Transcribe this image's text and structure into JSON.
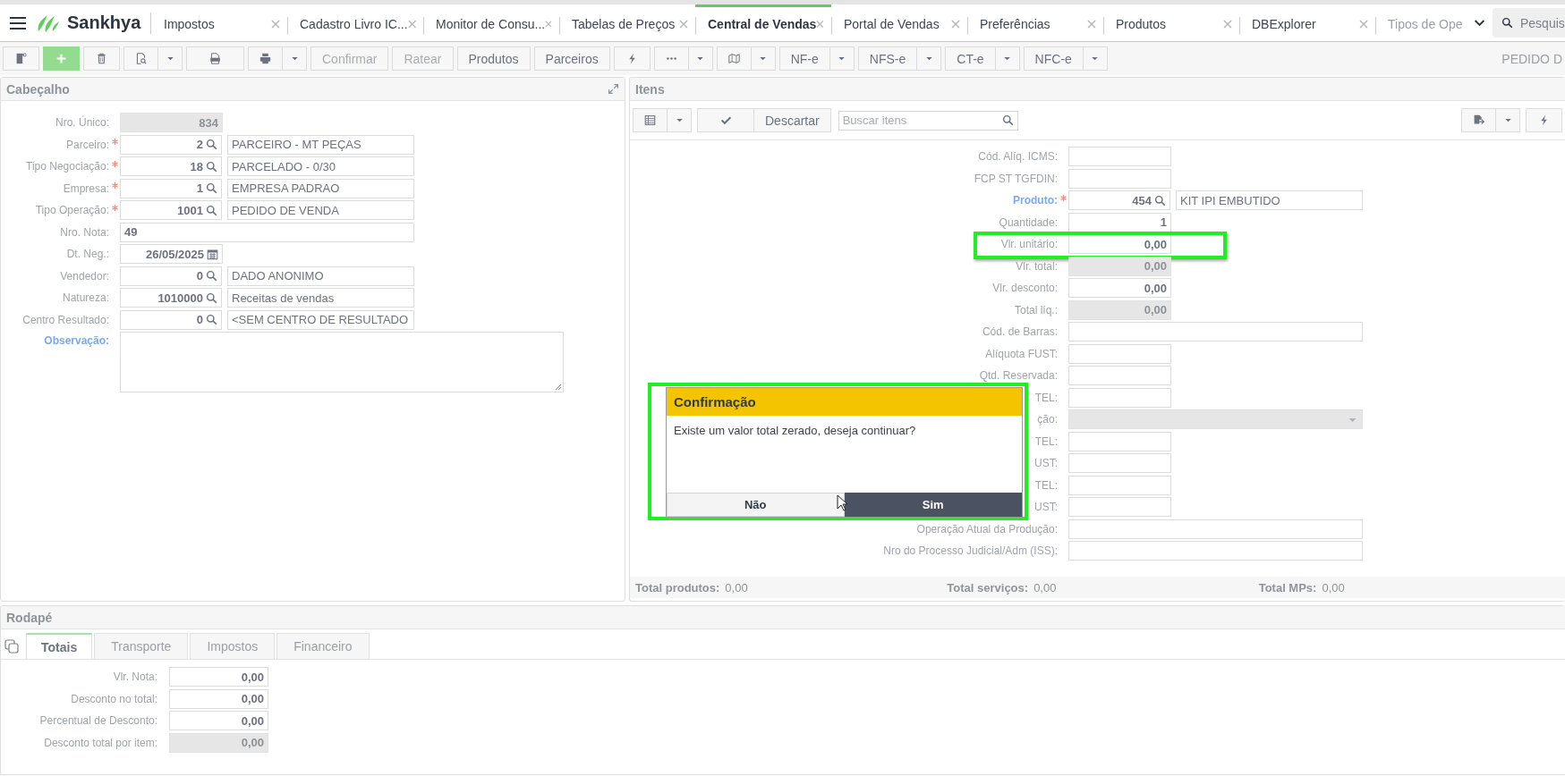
{
  "app": {
    "brand": "Sankhya"
  },
  "tabs": [
    {
      "label": "Impostos",
      "selected": false,
      "closable": true
    },
    {
      "label": "Cadastro Livro IC...",
      "selected": false,
      "closable": true
    },
    {
      "label": "Monitor de Consu...",
      "selected": false,
      "closable": true
    },
    {
      "label": "Tabelas de Preços",
      "selected": false,
      "closable": true
    },
    {
      "label": "Central de Vendas",
      "selected": true,
      "closable": true
    },
    {
      "label": "Portal de Vendas",
      "selected": false,
      "closable": true
    },
    {
      "label": "Preferências",
      "selected": false,
      "closable": true
    },
    {
      "label": "Produtos",
      "selected": false,
      "closable": true
    },
    {
      "label": "DBExplorer",
      "selected": false,
      "closable": true
    },
    {
      "label": "Tipos de Ope",
      "selected": false,
      "closable": false
    }
  ],
  "search": {
    "placeholder": "Pesquis"
  },
  "toolbar": [
    {
      "kind": "note",
      "dropdown": false
    },
    {
      "kind": "add",
      "dropdown": false
    },
    {
      "kind": "trash",
      "dropdown": false
    },
    {
      "kind": "report",
      "dropdown": true
    },
    {
      "kind": "pdf",
      "dropdown": false
    },
    {
      "kind": "print",
      "dropdown": true
    },
    {
      "kind": "text",
      "label": "Confirmar",
      "disabled": true,
      "dropdown": false
    },
    {
      "kind": "text",
      "label": "Ratear",
      "disabled": true,
      "dropdown": false
    },
    {
      "kind": "text",
      "label": "Produtos",
      "disabled": false,
      "dropdown": false
    },
    {
      "kind": "text",
      "label": "Parceiros",
      "disabled": false,
      "dropdown": false
    },
    {
      "kind": "flash",
      "dropdown": false
    },
    {
      "kind": "more",
      "dropdown": true
    },
    {
      "kind": "map",
      "dropdown": true
    },
    {
      "kind": "text",
      "label": "NF-e",
      "disabled": false,
      "dropdown": true
    },
    {
      "kind": "text",
      "label": "NFS-e",
      "disabled": false,
      "dropdown": true
    },
    {
      "kind": "text",
      "label": "CT-e",
      "disabled": false,
      "dropdown": true
    },
    {
      "kind": "text",
      "label": "NFC-e",
      "disabled": false,
      "dropdown": true
    }
  ],
  "document_title": "PEDIDO D",
  "header_panel": {
    "title": "Cabeçalho",
    "fields": [
      {
        "label": "Nro. Único:",
        "required": false,
        "linked": false,
        "kind": "short",
        "value": "834",
        "disabled": true
      },
      {
        "label": "Parceiro:",
        "required": true,
        "linked": false,
        "kind": "lookup",
        "value": "2",
        "description": "PARCEIRO - MT PEÇAS",
        "disabled": false
      },
      {
        "label": "Tipo Negociação:",
        "required": true,
        "linked": false,
        "kind": "lookup",
        "value": "18",
        "description": "PARCELADO - 0/30",
        "disabled": false
      },
      {
        "label": "Empresa:",
        "required": true,
        "linked": false,
        "kind": "lookup",
        "value": "1",
        "description": "EMPRESA PADRAO",
        "disabled": false
      },
      {
        "label": "Tipo Operação:",
        "required": true,
        "linked": false,
        "kind": "lookup",
        "value": "1001",
        "description": "PEDIDO DE VENDA",
        "disabled": false
      },
      {
        "label": "Nro. Nota:",
        "required": false,
        "linked": false,
        "kind": "wide",
        "value": "49",
        "disabled": false
      },
      {
        "label": "Dt. Neg.:",
        "required": false,
        "linked": false,
        "kind": "date",
        "value": "26/05/2025",
        "disabled": false
      },
      {
        "label": "Vendedor:",
        "required": false,
        "linked": false,
        "kind": "lookup",
        "value": "0",
        "description": "DADO ANONIMO",
        "disabled": false
      },
      {
        "label": "Natureza:",
        "required": false,
        "linked": false,
        "kind": "lookup",
        "value": "1010000",
        "description": "Receitas de vendas",
        "disabled": false
      },
      {
        "label": "Centro Resultado:",
        "required": false,
        "linked": false,
        "kind": "lookup",
        "value": "0",
        "description": "<SEM CENTRO DE RESULTADO",
        "disabled": false
      },
      {
        "label": "Observação:",
        "required": false,
        "linked": true,
        "kind": "memo"
      }
    ]
  },
  "items_panel": {
    "title": "Itens",
    "discard_label": "Descartar",
    "search_placeholder": "Buscar itens",
    "fields": [
      {
        "label": "Cód. Alíq. ICMS:",
        "required": false,
        "linked": false,
        "kind": "short",
        "disabled": false,
        "highlighted": false
      },
      {
        "label": "FCP ST TGFDIN:",
        "required": false,
        "linked": false,
        "kind": "short",
        "disabled": false,
        "highlighted": false
      },
      {
        "label": "Produto:",
        "required": true,
        "linked": true,
        "kind": "lookup",
        "value": "454",
        "description": "KIT IPI EMBUTIDO",
        "disabled": false,
        "highlighted": false
      },
      {
        "label": "Quantidade:",
        "required": false,
        "linked": false,
        "kind": "short",
        "value": "1",
        "disabled": false,
        "highlighted": false
      },
      {
        "label": "Vlr. unitário:",
        "required": false,
        "linked": false,
        "kind": "short",
        "value": "0,00",
        "disabled": false,
        "highlighted": true
      },
      {
        "label": "Vlr. total:",
        "required": false,
        "linked": false,
        "kind": "short",
        "value": "0,00",
        "disabled": true,
        "highlighted": false
      },
      {
        "label": "Vlr. desconto:",
        "required": false,
        "linked": false,
        "kind": "short",
        "value": "0,00",
        "disabled": false,
        "highlighted": false
      },
      {
        "label": "Total líq.:",
        "required": false,
        "linked": false,
        "kind": "short",
        "value": "0,00",
        "disabled": true,
        "highlighted": false
      },
      {
        "label": "Cód. de Barras:",
        "required": false,
        "linked": false,
        "kind": "wide",
        "disabled": false,
        "highlighted": false
      },
      {
        "label": "Alíquota FUST:",
        "required": false,
        "linked": false,
        "kind": "short",
        "disabled": false,
        "highlighted": false
      },
      {
        "label": "Qtd. Reservada:",
        "required": false,
        "linked": false,
        "kind": "short",
        "disabled": false,
        "highlighted": false
      },
      {
        "label": "TEL:",
        "required": false,
        "linked": false,
        "kind": "short",
        "disabled": false,
        "highlighted": false
      },
      {
        "label": "ção:",
        "required": false,
        "linked": false,
        "kind": "select",
        "disabled": true,
        "highlighted": false
      },
      {
        "label": "TEL:",
        "required": false,
        "linked": false,
        "kind": "short",
        "disabled": false,
        "highlighted": false
      },
      {
        "label": "UST:",
        "required": false,
        "linked": false,
        "kind": "short",
        "disabled": false,
        "highlighted": false
      },
      {
        "label": "TEL:",
        "required": false,
        "linked": false,
        "kind": "short",
        "disabled": false,
        "highlighted": false
      },
      {
        "label": "UST:",
        "required": false,
        "linked": false,
        "kind": "short",
        "disabled": false,
        "highlighted": false
      },
      {
        "label": "Operação Atual da Produção:",
        "required": false,
        "linked": false,
        "kind": "wide",
        "disabled": false,
        "highlighted": false
      },
      {
        "label": "Nro do Processo Judicial/Adm (ISS):",
        "required": false,
        "linked": false,
        "kind": "wide",
        "disabled": false,
        "highlighted": false
      }
    ],
    "totals": [
      {
        "label": "Total produtos:",
        "value": "0,00"
      },
      {
        "label": "Total serviços:",
        "value": "0,00"
      },
      {
        "label": "Total MPs:",
        "value": "0,00"
      }
    ]
  },
  "footer_panel": {
    "title": "Rodapé",
    "tabs": [
      {
        "label": "Totais",
        "selected": true
      },
      {
        "label": "Transporte",
        "selected": false
      },
      {
        "label": "Impostos",
        "selected": false
      },
      {
        "label": "Financeiro",
        "selected": false
      }
    ],
    "fields": [
      {
        "label": "Vlr. Nota:",
        "value": "0,00",
        "disabled": false
      },
      {
        "label": "Desconto no total:",
        "value": "0,00",
        "disabled": false
      },
      {
        "label": "Percentual de Desconto:",
        "value": "0,00",
        "disabled": false
      },
      {
        "label": "Desconto total por item:",
        "value": "0,00",
        "disabled": true
      }
    ]
  },
  "dialog": {
    "title": "Confirmação",
    "message": "Existe um valor total zerado, deseja continuar?",
    "highlighted": true,
    "buttons": [
      {
        "label": "Não",
        "primary": false
      },
      {
        "label": "Sim",
        "primary": true
      }
    ]
  }
}
